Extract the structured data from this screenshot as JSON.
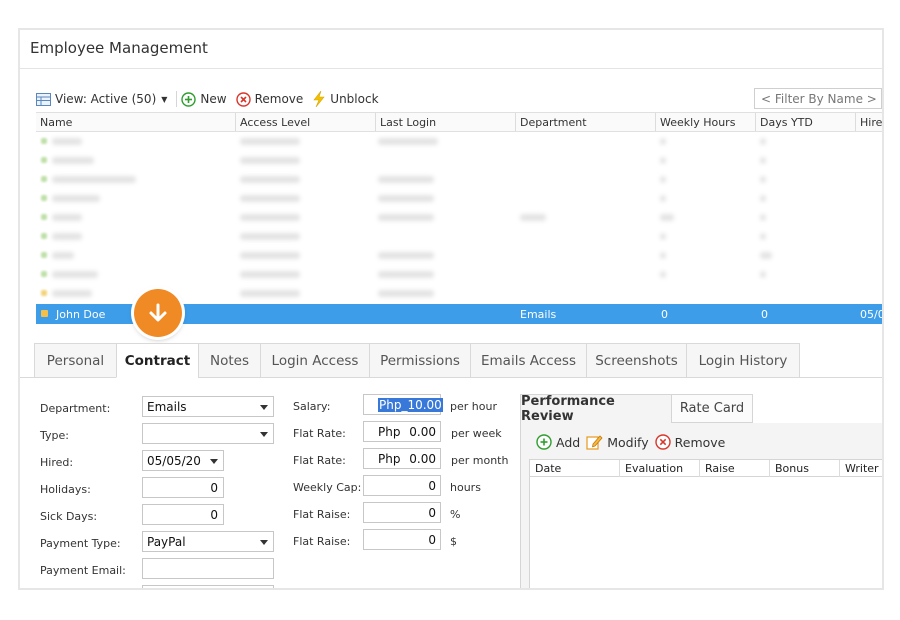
{
  "app": {
    "title": "Employee Management"
  },
  "toolbar": {
    "view_label": "View: Active (50)",
    "new_label": "New",
    "remove_label": "Remove",
    "unblock_label": "Unblock",
    "filter_placeholder": "< Filter By Name >"
  },
  "grid": {
    "columns": [
      "Name",
      "Access Level",
      "Last Login",
      "Department",
      "Weekly Hours",
      "Days YTD",
      "Hire"
    ],
    "selected_row": {
      "name": "John Doe",
      "department": "Emails",
      "weekly_hours": "0",
      "days_ytd": "0",
      "hire": "05/0"
    }
  },
  "tabs": [
    "Personal",
    "Contract",
    "Notes",
    "Login Access",
    "Permissions",
    "Emails Access",
    "Screenshots",
    "Login History"
  ],
  "active_tab": "Contract",
  "contract": {
    "department_label": "Department:",
    "department_value": "Emails",
    "type_label": "Type:",
    "type_value": "",
    "hired_label": "Hired:",
    "hired_value": "05/05/20",
    "holidays_label": "Holidays:",
    "holidays_value": "0",
    "sick_days_label": "Sick Days:",
    "sick_days_value": "0",
    "payment_type_label": "Payment Type:",
    "payment_type_value": "PayPal",
    "payment_email_label": "Payment Email:",
    "payment_email_value": "",
    "salary_label": "Salary:",
    "salary_value": "Php_10.00",
    "salary_unit": "per hour",
    "flat_rate_week_label": "Flat Rate:",
    "flat_rate_week_currency": "Php",
    "flat_rate_week_value": "0.00",
    "flat_rate_week_unit": "per week",
    "flat_rate_month_label": "Flat Rate:",
    "flat_rate_month_currency": "Php",
    "flat_rate_month_value": "0.00",
    "flat_rate_month_unit": "per month",
    "weekly_cap_label": "Weekly Cap:",
    "weekly_cap_value": "0",
    "weekly_cap_unit": "hours",
    "flat_raise_pct_label": "Flat Raise:",
    "flat_raise_pct_value": "0",
    "flat_raise_pct_unit": "%",
    "flat_raise_amt_label": "Flat Raise:",
    "flat_raise_amt_value": "0",
    "flat_raise_amt_unit": "$"
  },
  "performance": {
    "tab_review": "Performance Review",
    "tab_rate_card": "Rate Card",
    "add_label": "Add",
    "modify_label": "Modify",
    "remove_label": "Remove",
    "columns": [
      "Date",
      "Evaluation",
      "Raise",
      "Bonus",
      "Writer"
    ]
  },
  "colors": {
    "selection": "#3d9de8",
    "accent_orange": "#f08a24",
    "add_green": "#2e9e2e",
    "remove_red": "#d9362b",
    "unblock_yellow": "#f2c200"
  }
}
